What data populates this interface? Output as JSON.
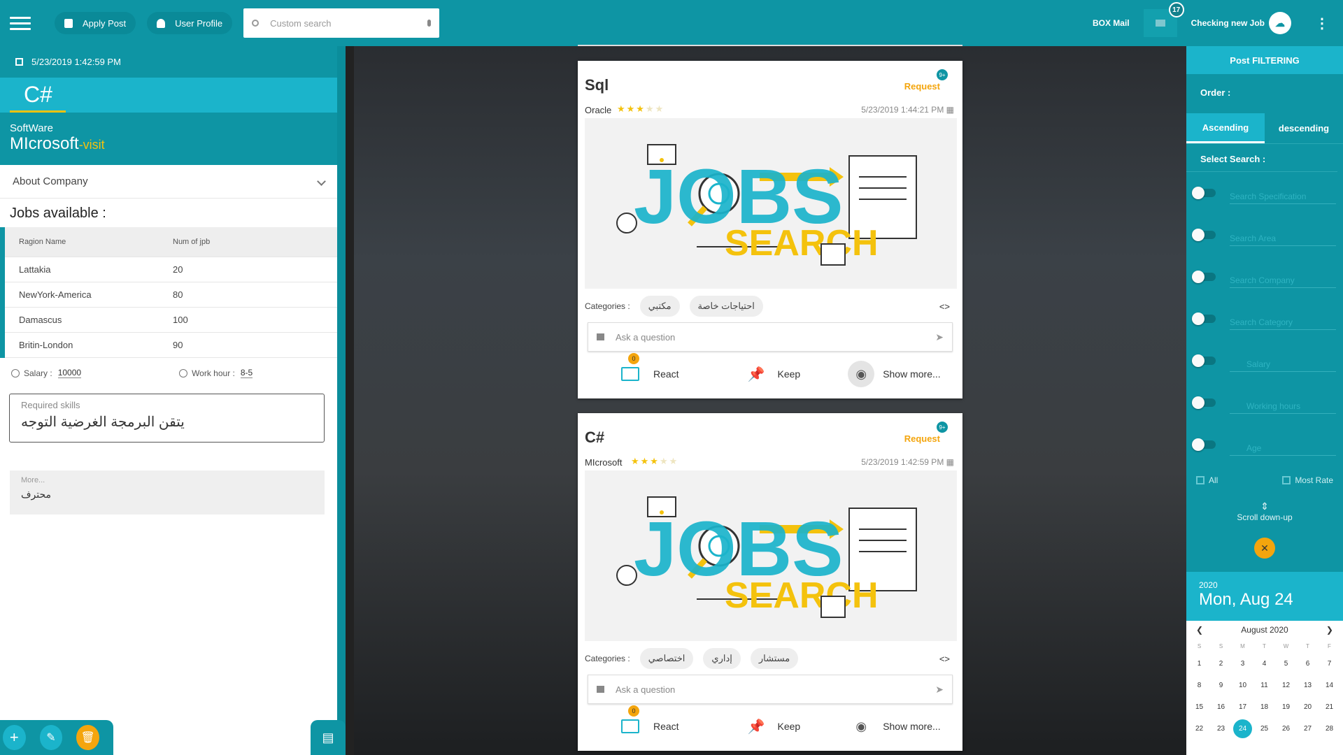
{
  "topbar": {
    "apply_post": "Apply Post",
    "user_profile": "User Profile",
    "search_placeholder": "Custom search",
    "box_mail": "BOX Mail",
    "mail_badge": "17",
    "checking_job": "Checking new Job"
  },
  "left": {
    "date": "5/23/2019 1:42:59 PM",
    "language": "C#",
    "category": "SoftWare",
    "company": "MIcrosoft",
    "visit": "-visit",
    "about": "About Company",
    "jobs_title": "Jobs available :",
    "table": {
      "headers": [
        "Ragion Name",
        "Num of jpb"
      ],
      "rows": [
        [
          "Lattakia",
          "20"
        ],
        [
          "NewYork-America",
          "80"
        ],
        [
          "Damascus",
          "100"
        ],
        [
          "Britin-London",
          "90"
        ]
      ]
    },
    "salary_label": "Salary :",
    "salary": "10000",
    "work_label": "Work hour :",
    "work_hours": "8-5",
    "skills_label": "Required skills",
    "skills": "يتقن البرمجة الغرضية التوجه",
    "more_label": "More...",
    "more": "محترف"
  },
  "posts": [
    {
      "title": "Sql",
      "request": "Request",
      "badge": "9+",
      "company": "Oracle",
      "rating": 3,
      "date": "5/23/2019 1:44:21 PM",
      "categories_label": "Categories :",
      "categories": [
        "مكتبي",
        "احتياجات خاصة"
      ],
      "ask_placeholder": "Ask a question",
      "react_count": "0",
      "react": "React",
      "keep": "Keep",
      "show_more": "Show more..."
    },
    {
      "title": "C#",
      "request": "Request",
      "badge": "9+",
      "company": "MIcrosoft",
      "rating": 3,
      "date": "5/23/2019 1:42:59 PM",
      "categories_label": "Categories :",
      "categories": [
        "اختصاصي",
        "إداري",
        "مستشار"
      ],
      "ask_placeholder": "Ask a question",
      "react_count": "0",
      "react": "React",
      "keep": "Keep",
      "show_more": "Show more..."
    }
  ],
  "image_text": {
    "top": "JOBS",
    "bottom": "SEARCH"
  },
  "filter": {
    "title": "Post FILTERING",
    "order": "Order :",
    "ascending": "Ascending",
    "descending": "descending",
    "select": "Select Search :",
    "fields": [
      "Search Specification",
      "Search Area",
      "Search Company",
      "Search Category",
      "Salary",
      "Working hours",
      "Age"
    ],
    "all": "All",
    "most_rate": "Most Rate",
    "scroll": "Scroll down-up"
  },
  "calendar": {
    "year": "2020",
    "day": "Mon, Aug 24",
    "month": "August 2020",
    "weekdays": [
      "S",
      "S",
      "M",
      "T",
      "W",
      "T",
      "F"
    ],
    "selected": "24"
  },
  "colors": {
    "primary": "#0e95a4",
    "accent": "#1bb4cb",
    "amber": "#f4a50d"
  }
}
